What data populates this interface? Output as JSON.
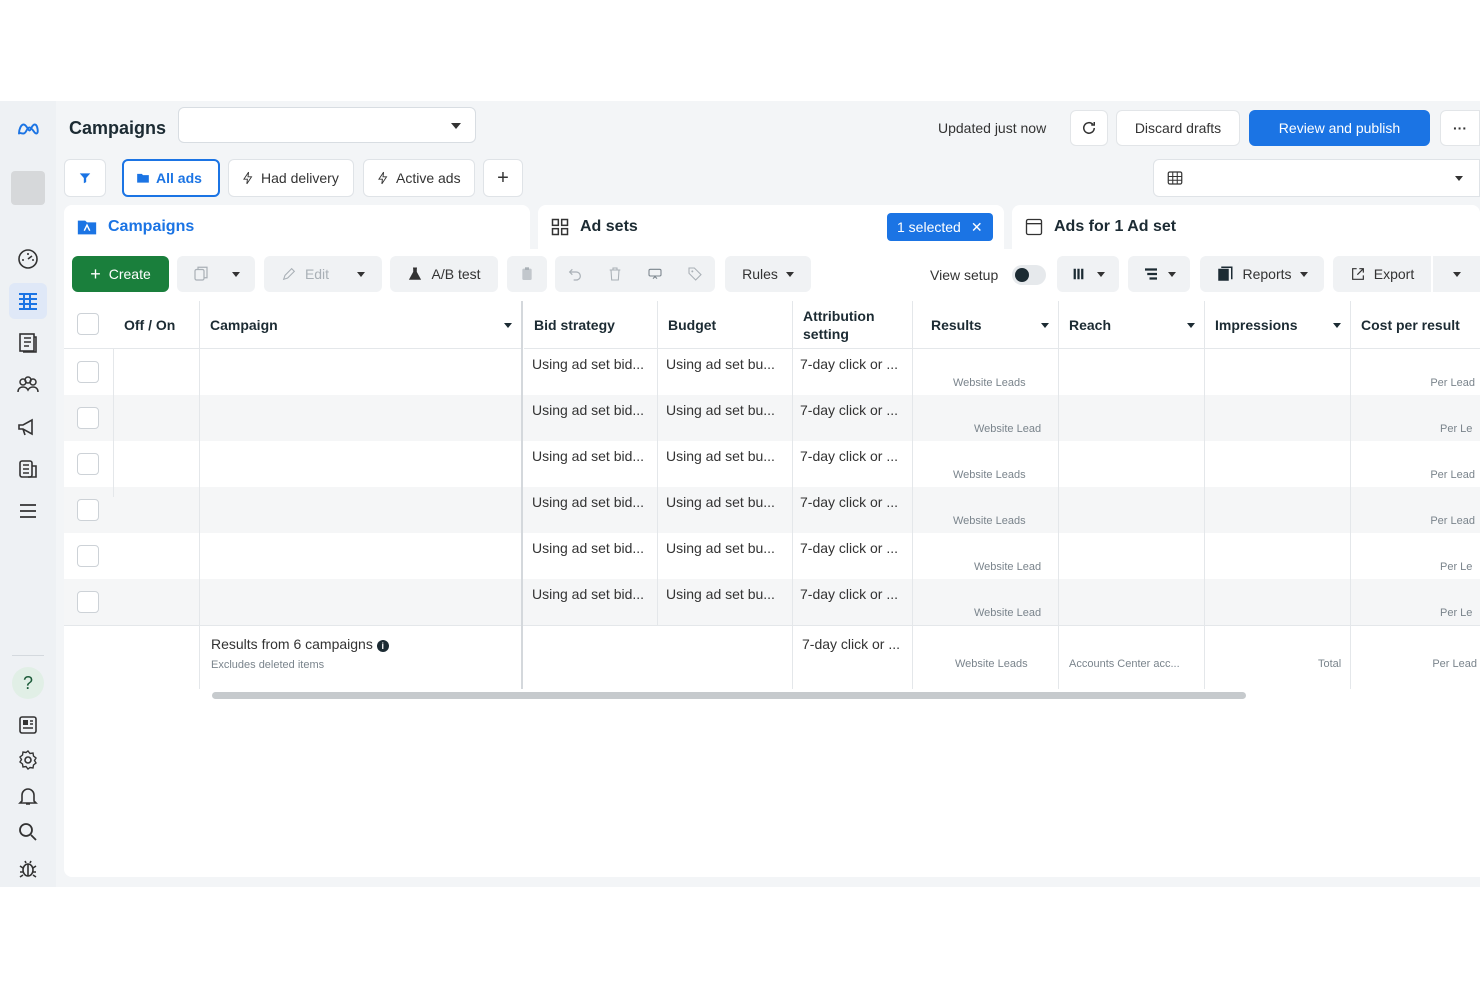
{
  "header": {
    "title": "Campaigns",
    "dropdown_value": "",
    "updated": "Updated just now",
    "discard": "Discard drafts",
    "publish": "Review and publish",
    "more": "···"
  },
  "filters": {
    "all_ads": "All ads",
    "had_delivery": "Had delivery",
    "active_ads": "Active ads",
    "add": "+"
  },
  "tabs": {
    "campaigns": "Campaigns",
    "ad_sets": "Ad sets",
    "selected": "1 selected",
    "ads": "Ads for 1 Ad set"
  },
  "toolbar": {
    "create": "Create",
    "edit": "Edit",
    "ab_test": "A/B test",
    "rules": "Rules",
    "view_setup": "View setup",
    "reports": "Reports",
    "export": "Export"
  },
  "table": {
    "headers": [
      "Off / On",
      "Campaign",
      "Bid strategy",
      "Budget",
      "Attribution setting",
      "Results",
      "Reach",
      "Impressions",
      "Cost per result"
    ],
    "rows": [
      {
        "bid": "Using ad set bid...",
        "budget": "Using ad set bu...",
        "attribution": "7-day click or ...",
        "results": "Website Leads",
        "cost": "Per Lead"
      },
      {
        "bid": "Using ad set bid...",
        "budget": "Using ad set bu...",
        "attribution": "7-day click or ...",
        "results": "Website Lead",
        "cost": "Per Le"
      },
      {
        "bid": "Using ad set bid...",
        "budget": "Using ad set bu...",
        "attribution": "7-day click or ...",
        "results": "Website Leads",
        "cost": "Per Lead"
      },
      {
        "bid": "Using ad set bid...",
        "budget": "Using ad set bu...",
        "attribution": "7-day click or ...",
        "results": "Website Leads",
        "cost": "Per Lead"
      },
      {
        "bid": "Using ad set bid...",
        "budget": "Using ad set bu...",
        "attribution": "7-day click or ...",
        "results": "Website Lead",
        "cost": "Per Le"
      },
      {
        "bid": "Using ad set bid...",
        "budget": "Using ad set bu...",
        "attribution": "7-day click or ...",
        "results": "Website Lead",
        "cost": "Per Le"
      }
    ],
    "footer": {
      "results_from": "Results from 6 campaigns",
      "excludes": "Excludes deleted items",
      "attribution": "7-day click or ...",
      "results": "Website Leads",
      "reach": "Accounts Center acc...",
      "impressions": "Total",
      "cost": "Per Lead"
    }
  },
  "colors": {
    "accent": "#1b74e4",
    "create": "#1a7f3c"
  }
}
